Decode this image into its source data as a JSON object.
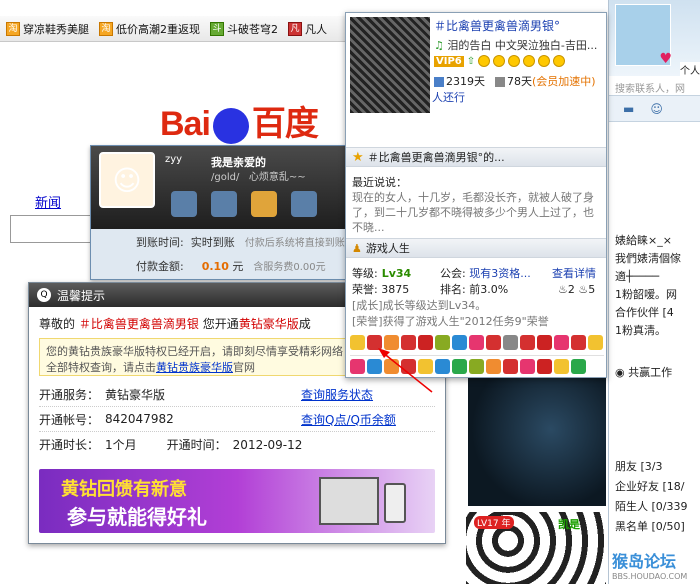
{
  "bookmarks": [
    {
      "label": "穿凉鞋秀美腿"
    },
    {
      "label": "低价高潮2重返现"
    },
    {
      "label": "斗破苍穹2"
    },
    {
      "label": "凡人"
    }
  ],
  "baidu": {
    "logo_left": "Bai",
    "logo_right": "百度",
    "news_link": "新闻"
  },
  "qq_card": {
    "nick": "我是亲爱的",
    "sub": "/gold/",
    "sign": "心烦意乱~~",
    "username": "zyy",
    "arrival_label": "到账时间:",
    "arrival_value": "实时到账",
    "arrival_note": "付款后系统将直接到账",
    "amount_label": "付款金额:",
    "amount_value": "0.10",
    "amount_unit": "元",
    "amount_note": "含服务费0.00元"
  },
  "tip": {
    "title": "温馨提示",
    "greet_prefix": "尊敬的",
    "greet_nick": "＃比禽兽更禽兽滴男银",
    "greet_middle": "您开通",
    "greet_product": "黄钻豪华版",
    "greet_suffix": "成",
    "notice_text": "您的黄钻贵族豪华版特权已经开启，请即刻尽情享受精彩网络",
    "notice_text2": "全部特权查询，请点击",
    "notice_link": "黄钻贵族豪华版",
    "notice_suffix": "官网",
    "service_label": "开通服务：",
    "service_value": "黄钻豪华版",
    "service_link": "查询服务状态",
    "account_label": "开通帐号：",
    "account_value": "842047982",
    "account_link": "查询Q点/Q币余额",
    "duration_label": "开通时长：",
    "duration_value": "1个月",
    "time_label": "开通时间：",
    "time_value": "2012-09-12",
    "banner_line1": "黄钻回馈有新意",
    "banner_line2": "参与就能得好礼"
  },
  "profile": {
    "nick": "＃比禽兽更禽兽滴男银°",
    "song": "泪的告白 中文哭泣独白-吉田...",
    "vip": "VIP6",
    "days1": "2319天",
    "days2": "78天",
    "accel": "(会员加速中)",
    "status": "人还行",
    "section1_title": "＃比禽兽更禽兽滴男银°的...",
    "talk_label": "最近说说：",
    "talk_text": "现在的女人，十几岁，毛都没长齐，就被人破了身了，到二十几岁都不晓得被多少个男人上过了，也不晓...",
    "section2_title": "游戏人生",
    "level_label": "等级:",
    "level_value": "Lv34",
    "merit_label": "公会:",
    "merit_value": "现有3资格...",
    "detail_link": "查看详情",
    "honor_label": "荣誉:",
    "honor_value": "3875",
    "rank_label": "排名:",
    "rank_value": "前3.0%",
    "medal_count": "2",
    "medal_count2": "5",
    "event1": "[成长]成长等级达到Lv34。",
    "event2": "[荣誉]获得了游戏人生\"2012任务9\"荣誉"
  },
  "sidebar": {
    "label": "个人",
    "search_placeholder": "搜索联系人，网",
    "items": [
      "婊給睐×_×",
      "我們婊淸個傢",
      "適┼────",
      "1粉韶嗳。网",
      "合作伙伴 [4",
      "1粉真淸。",
      "共赢工作"
    ],
    "groups": [
      {
        "label": "朋友",
        "count": "[3/3"
      },
      {
        "label": "企业好友",
        "count": "[18/"
      },
      {
        "label": "陌生人",
        "count": "[0/339"
      },
      {
        "label": "黑名单",
        "count": "[0/50]"
      }
    ]
  },
  "photo": {
    "badge": "LV17 年",
    "name": "凯是"
  },
  "watermark": {
    "title": "猴岛论坛",
    "url": "BBS.HOUDAO.COM"
  },
  "colors": {
    "accent_red": "#d20000",
    "link_blue": "#0033cc",
    "qq_header": "#2c2c2c"
  }
}
